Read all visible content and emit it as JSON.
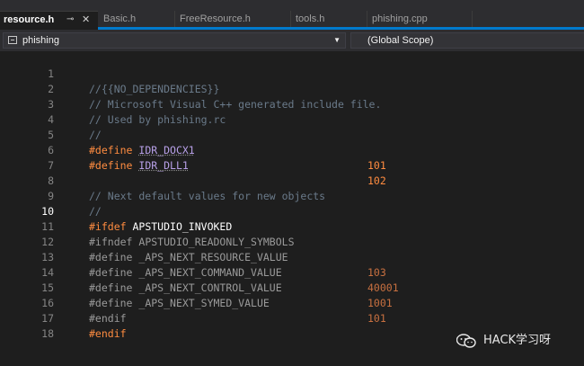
{
  "tabs": [
    {
      "label": "resource.h",
      "pin": "⊸",
      "close": "✕"
    },
    {
      "label": "Basic.h"
    },
    {
      "label": "FreeResource.h"
    },
    {
      "label": "tools.h"
    },
    {
      "label": "phishing.cpp"
    }
  ],
  "nav": {
    "project": "phishing",
    "scope": "(Global Scope)"
  },
  "lines": [
    {
      "n": "1",
      "text": "//{{NO_DEPENDENCIES}}"
    },
    {
      "n": "2",
      "text": "// Microsoft Visual C++ generated include file."
    },
    {
      "n": "3",
      "text": "// Used by phishing.rc"
    },
    {
      "n": "4",
      "text": "//"
    },
    {
      "n": "5",
      "kw": "#define",
      "name": "IDR_DOCX1",
      "val": "101"
    },
    {
      "n": "6",
      "kw": "#define",
      "name": "IDR_DLL1",
      "val": "102"
    },
    {
      "n": "7"
    },
    {
      "n": "8",
      "text": "// Next default values for new objects"
    },
    {
      "n": "9",
      "text": "//"
    },
    {
      "n": "10",
      "kw": "#ifdef",
      "name": "APSTUDIO_INVOKED"
    },
    {
      "n": "11",
      "kw": "#ifndef",
      "name": "APSTUDIO_READONLY_SYMBOLS"
    },
    {
      "n": "12",
      "kw": "#define",
      "name": "_APS_NEXT_RESOURCE_VALUE",
      "val": "103"
    },
    {
      "n": "13",
      "kw": "#define",
      "name": "_APS_NEXT_COMMAND_VALUE",
      "val": "40001"
    },
    {
      "n": "14",
      "kw": "#define",
      "name": "_APS_NEXT_CONTROL_VALUE",
      "val": "1001"
    },
    {
      "n": "15",
      "kw": "#define",
      "name": "_APS_NEXT_SYMED_VALUE",
      "val": "101"
    },
    {
      "n": "16",
      "kw": "#endif"
    },
    {
      "n": "17",
      "kw": "#endif"
    },
    {
      "n": "18"
    }
  ],
  "watermark": "HACK学习呀",
  "colors": {
    "accent": "#007acc",
    "number": "#ff8c40",
    "keyword": "#ff8c40",
    "comment": "#6a7a8a",
    "macro": "#b8a0e8"
  }
}
